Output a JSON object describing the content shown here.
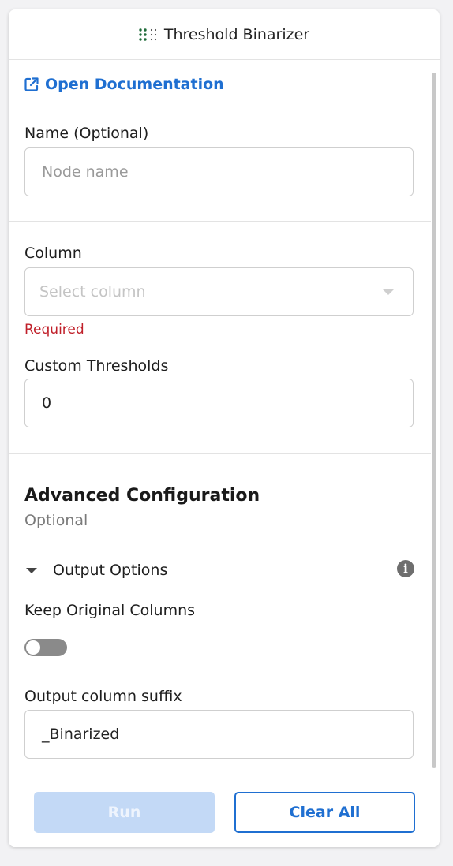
{
  "header": {
    "title": "Threshold Binarizer",
    "icon": "dot-grid-icon",
    "icon_color": "#1f6b3a"
  },
  "doc_link": {
    "label": "Open Documentation",
    "icon": "external-link-icon",
    "color": "#1f6fd1"
  },
  "name_field": {
    "label": "Name (Optional)",
    "placeholder": "Node name",
    "value": ""
  },
  "column_field": {
    "label": "Column",
    "placeholder": "Select column",
    "value": "",
    "error": "Required"
  },
  "thresholds_field": {
    "label": "Custom Thresholds",
    "value": "0"
  },
  "advanced": {
    "title": "Advanced Configuration",
    "subtitle": "Optional",
    "output_options": {
      "label": "Output Options",
      "expanded": true,
      "keep_original_columns": {
        "label": "Keep Original Columns",
        "checked": false
      },
      "suffix_field": {
        "label": "Output column suffix",
        "value": "_Binarized"
      }
    }
  },
  "footer": {
    "run_label": "Run",
    "run_disabled": true,
    "clear_label": "Clear All"
  },
  "colors": {
    "accent": "#1f6fd1",
    "error": "#c0202a",
    "run_disabled_bg": "#c3d9f6"
  }
}
